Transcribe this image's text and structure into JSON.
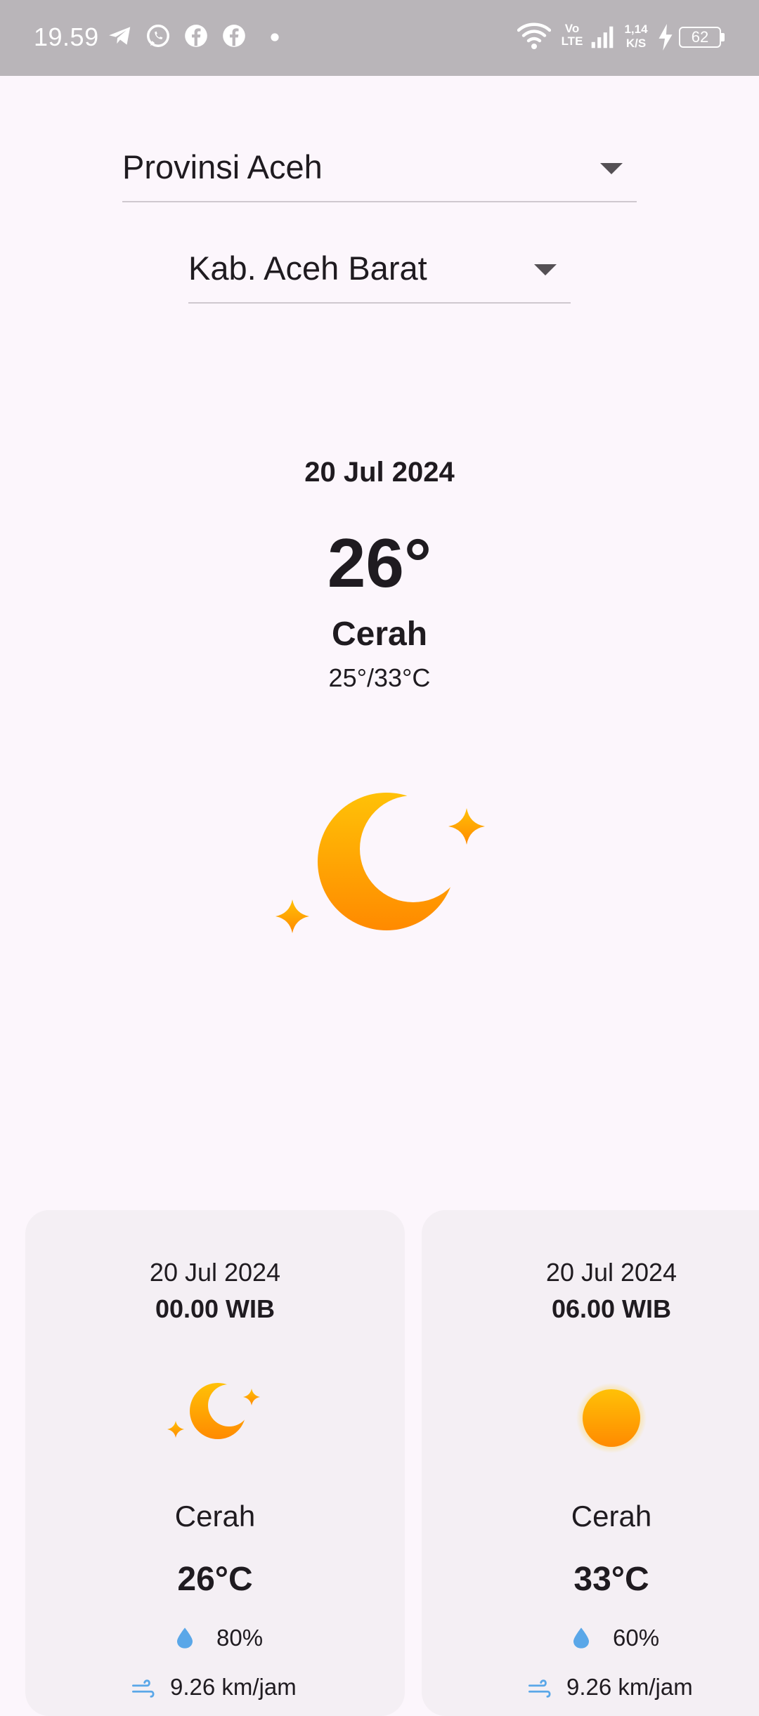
{
  "status_bar": {
    "time": "19.59",
    "network_speed_top": "1,14",
    "network_speed_unit": "K/S",
    "volte_top": "Vo",
    "volte_bottom": "LTE",
    "battery": "62",
    "notification_icons": [
      "telegram-icon",
      "whatsapp-icon",
      "facebook-icon",
      "facebook-icon",
      "dot-icon"
    ]
  },
  "province_select": {
    "value": "Provinsi Aceh"
  },
  "regency_select": {
    "value": "Kab. Aceh Barat"
  },
  "current": {
    "date": "20 Jul 2024",
    "temperature": "26°",
    "condition": "Cerah",
    "range": "25°/33°C",
    "icon": "moon-stars-icon"
  },
  "forecast": [
    {
      "date": "20 Jul 2024",
      "time": "00.00 WIB",
      "icon": "moon-stars-icon",
      "condition": "Cerah",
      "temperature": "26°C",
      "humidity": "80%",
      "wind": "9.26 km/jam"
    },
    {
      "date": "20 Jul 2024",
      "time": "06.00 WIB",
      "icon": "sun-icon",
      "condition": "Cerah",
      "temperature": "33°C",
      "humidity": "60%",
      "wind": "9.26 km/jam"
    }
  ],
  "colors": {
    "background": "#fcf6fc",
    "card": "#f4eff4",
    "status_bar": "#b9b5b9",
    "icon_gradient_top": "#ffc107",
    "icon_gradient_bottom": "#ff8a00",
    "drop": "#5aa7e8"
  }
}
